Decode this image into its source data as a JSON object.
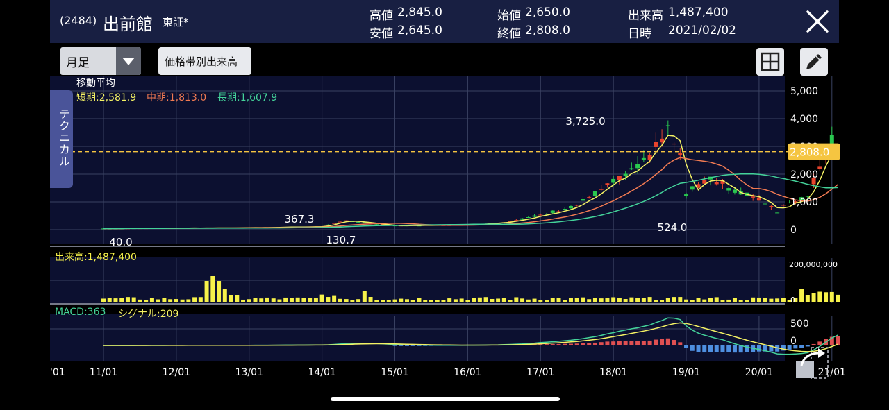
{
  "header": {
    "code": "(2484)",
    "name": "出前館",
    "market": "東証*",
    "high_label": "高値",
    "high_value": "2,845.0",
    "low_label": "安値",
    "low_value": "2,645.0",
    "open_label": "始値",
    "open_value": "2,650.0",
    "close_label": "終値",
    "close_value": "2,808.0",
    "volume_label": "出来高",
    "volume_value": "1,487,400",
    "date_label": "日時",
    "date_value": "2021/02/02"
  },
  "toolbar": {
    "period_select": "月足",
    "volume_by_price_button": "価格帯別出来高"
  },
  "side_tab": {
    "label": "テクニカル"
  },
  "legend": {
    "ma_title": "移動平均",
    "short_label": "短期:2,581.9",
    "mid_label": "中期:1,813.0",
    "long_label": "長期:1,607.9",
    "volume_label": "出来高:1,487,400",
    "macd_label": "MACD:363",
    "signal_label": "シグナル:209"
  },
  "colors": {
    "up": "#e8442d",
    "down": "#29c84f",
    "short_ma": "#f4f264",
    "mid_ma": "#f07a52",
    "long_ma": "#44d39a",
    "volume": "#f7f24a",
    "current_price": "#f5c541",
    "grid": "#3a4262",
    "panel_bg": "#0c1030",
    "macd_pos": "#e05052",
    "macd_neg": "#4e8fe0"
  },
  "icons": [
    "close-icon",
    "dropdown-arrow-icon",
    "grid-layout-icon",
    "pencil-icon",
    "share-icon"
  ],
  "chart_data": [
    {
      "type": "candlestick",
      "title": "移動平均",
      "x_tick_labels": [
        "'01",
        "11/01",
        "12/01",
        "13/01",
        "14/01",
        "15/01",
        "16/01",
        "17/01",
        "18/01",
        "19/01",
        "20/01",
        "21/01"
      ],
      "y_tick_labels": [
        "5,000",
        "4,000",
        "3,000",
        "2,000",
        "1,000",
        "0"
      ],
      "ylim": [
        0,
        5000
      ],
      "current_price": "2,808.0",
      "annotations": [
        "3,725.0",
        "367.3",
        "130.7",
        "40.0",
        "524.0"
      ],
      "series": [
        {
          "name": "短期",
          "last": 2581.9
        },
        {
          "name": "中期",
          "last": 1813.0
        },
        {
          "name": "長期",
          "last": 1607.9
        }
      ],
      "approx_closes_2016_2021": [
        {
          "x": "16/01",
          "close": 300
        },
        {
          "x": "17/01",
          "close": 700
        },
        {
          "x": "18/01",
          "close": 2300
        },
        {
          "x": "18/09",
          "close": 3725
        },
        {
          "x": "19/01",
          "close": 1700
        },
        {
          "x": "20/01",
          "close": 1200
        },
        {
          "x": "20/04",
          "close": 524
        },
        {
          "x": "21/01",
          "close": 2808
        }
      ]
    },
    {
      "type": "bar",
      "title": "出来高",
      "y_tick_labels": [
        "200,000,000",
        "0"
      ],
      "last": 1487400
    },
    {
      "type": "line",
      "title": "MACD",
      "y_tick_labels": [
        "500",
        "0"
      ],
      "series": [
        {
          "name": "MACD",
          "last": 363
        },
        {
          "name": "シグナル",
          "last": 209
        }
      ]
    }
  ]
}
